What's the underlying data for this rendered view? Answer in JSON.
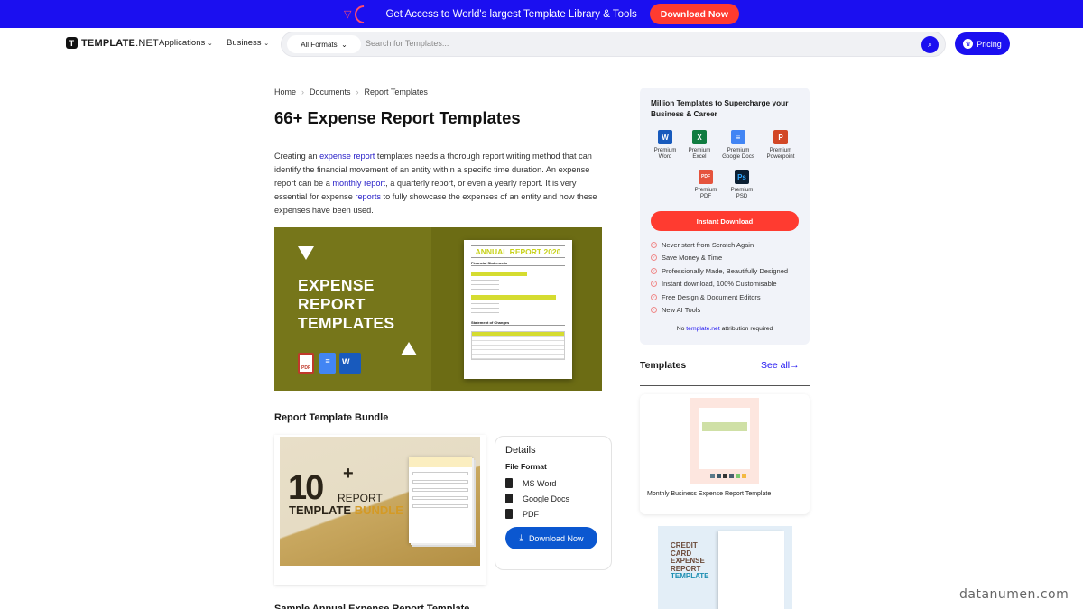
{
  "promo_bar": {
    "text": "Get Access to World's largest Template Library & Tools",
    "button": "Download Now",
    "bg_color": "#1b0ff0",
    "button_color": "#ff3b30"
  },
  "nav": {
    "logo_bold": "TEMPLATE",
    "logo_suffix": ".NET",
    "logo_mark": "T",
    "links": [
      {
        "label": "Applications",
        "icon": "chevron-down-icon"
      },
      {
        "label": "Business",
        "icon": "chevron-down-icon"
      }
    ],
    "format_select": "All Formats",
    "search_placeholder": "Search for Templates...",
    "pricing": "Pricing"
  },
  "breadcrumb": [
    "Home",
    "Documents",
    "Report Templates"
  ],
  "page_title": "66+ Expense Report Templates",
  "intro": {
    "p1": "Creating an ",
    "link1": "expense report",
    "p2": " templates needs a thorough report writing method that can identify the financial movement of an entity within a specific time duration. An expense report can be a ",
    "link2": "monthly report",
    "p3": ", a quarterly report, or even a yearly report. It is very essential for expense ",
    "link3": "reports",
    "p4": " to fully showcase the expenses of an entity and how these expenses have been used."
  },
  "hero": {
    "title_lines": [
      "EXPENSE",
      "REPORT",
      "TEMPLATES"
    ],
    "doc_title": "ANNUAL REPORT 2020",
    "doc_sections": [
      "Financial Statements",
      "Statement of Changes"
    ],
    "format_icons": [
      "pdf-icon",
      "google-docs-icon",
      "word-icon"
    ]
  },
  "bundle": {
    "section_title": "Report Template Bundle",
    "image_big": "10",
    "image_plus": "+",
    "image_line1": "REPORT",
    "image_line2a": "TEMPLATE ",
    "image_line2b": "BUNDLE",
    "details_title": "Details",
    "file_format_label": "File Format",
    "formats": [
      "MS Word",
      "Google Docs",
      "PDF"
    ],
    "download": "Download Now"
  },
  "next_section_title": "Sample Annual Expense Report Template",
  "sidebar": {
    "promo_title": "Million Templates to Supercharge your Business & Career",
    "apps": [
      {
        "label1": "Premium",
        "label2": "Word",
        "glyph": "W",
        "color": "#185abd"
      },
      {
        "label1": "Premium",
        "label2": "Excel",
        "glyph": "X",
        "color": "#107c41"
      },
      {
        "label1": "Premium",
        "label2": "Google Docs",
        "glyph": "≡",
        "color": "#4285f4"
      },
      {
        "label1": "Premium",
        "label2": "Powerpoint",
        "glyph": "P",
        "color": "#d24726"
      },
      {
        "label1": "Premium",
        "label2": "PDF",
        "glyph": "PDF",
        "color": "#e5533d"
      },
      {
        "label1": "Premium",
        "label2": "PSD",
        "glyph": "Ps",
        "color": "#0b1f33"
      }
    ],
    "instant_download": "Instant Download",
    "features": [
      "Never start from Scratch Again",
      "Save Money & Time",
      "Professionally Made, Beautifully Designed",
      "Instant download, 100% Customisable",
      "Free Design & Document Editors",
      "New AI Tools"
    ],
    "attr_pre": "No ",
    "attr_link": "template.net",
    "attr_post": " attribution required",
    "templates_heading": "Templates",
    "see_all": "See all→",
    "template_cards": [
      {
        "title": "Monthly Business Expense Report Template"
      },
      {
        "title": "",
        "image_text1": "CREDIT CARD EXPENSE REPORT",
        "image_text2": "TEMPLATE"
      }
    ]
  },
  "watermark": "datanumen.com"
}
